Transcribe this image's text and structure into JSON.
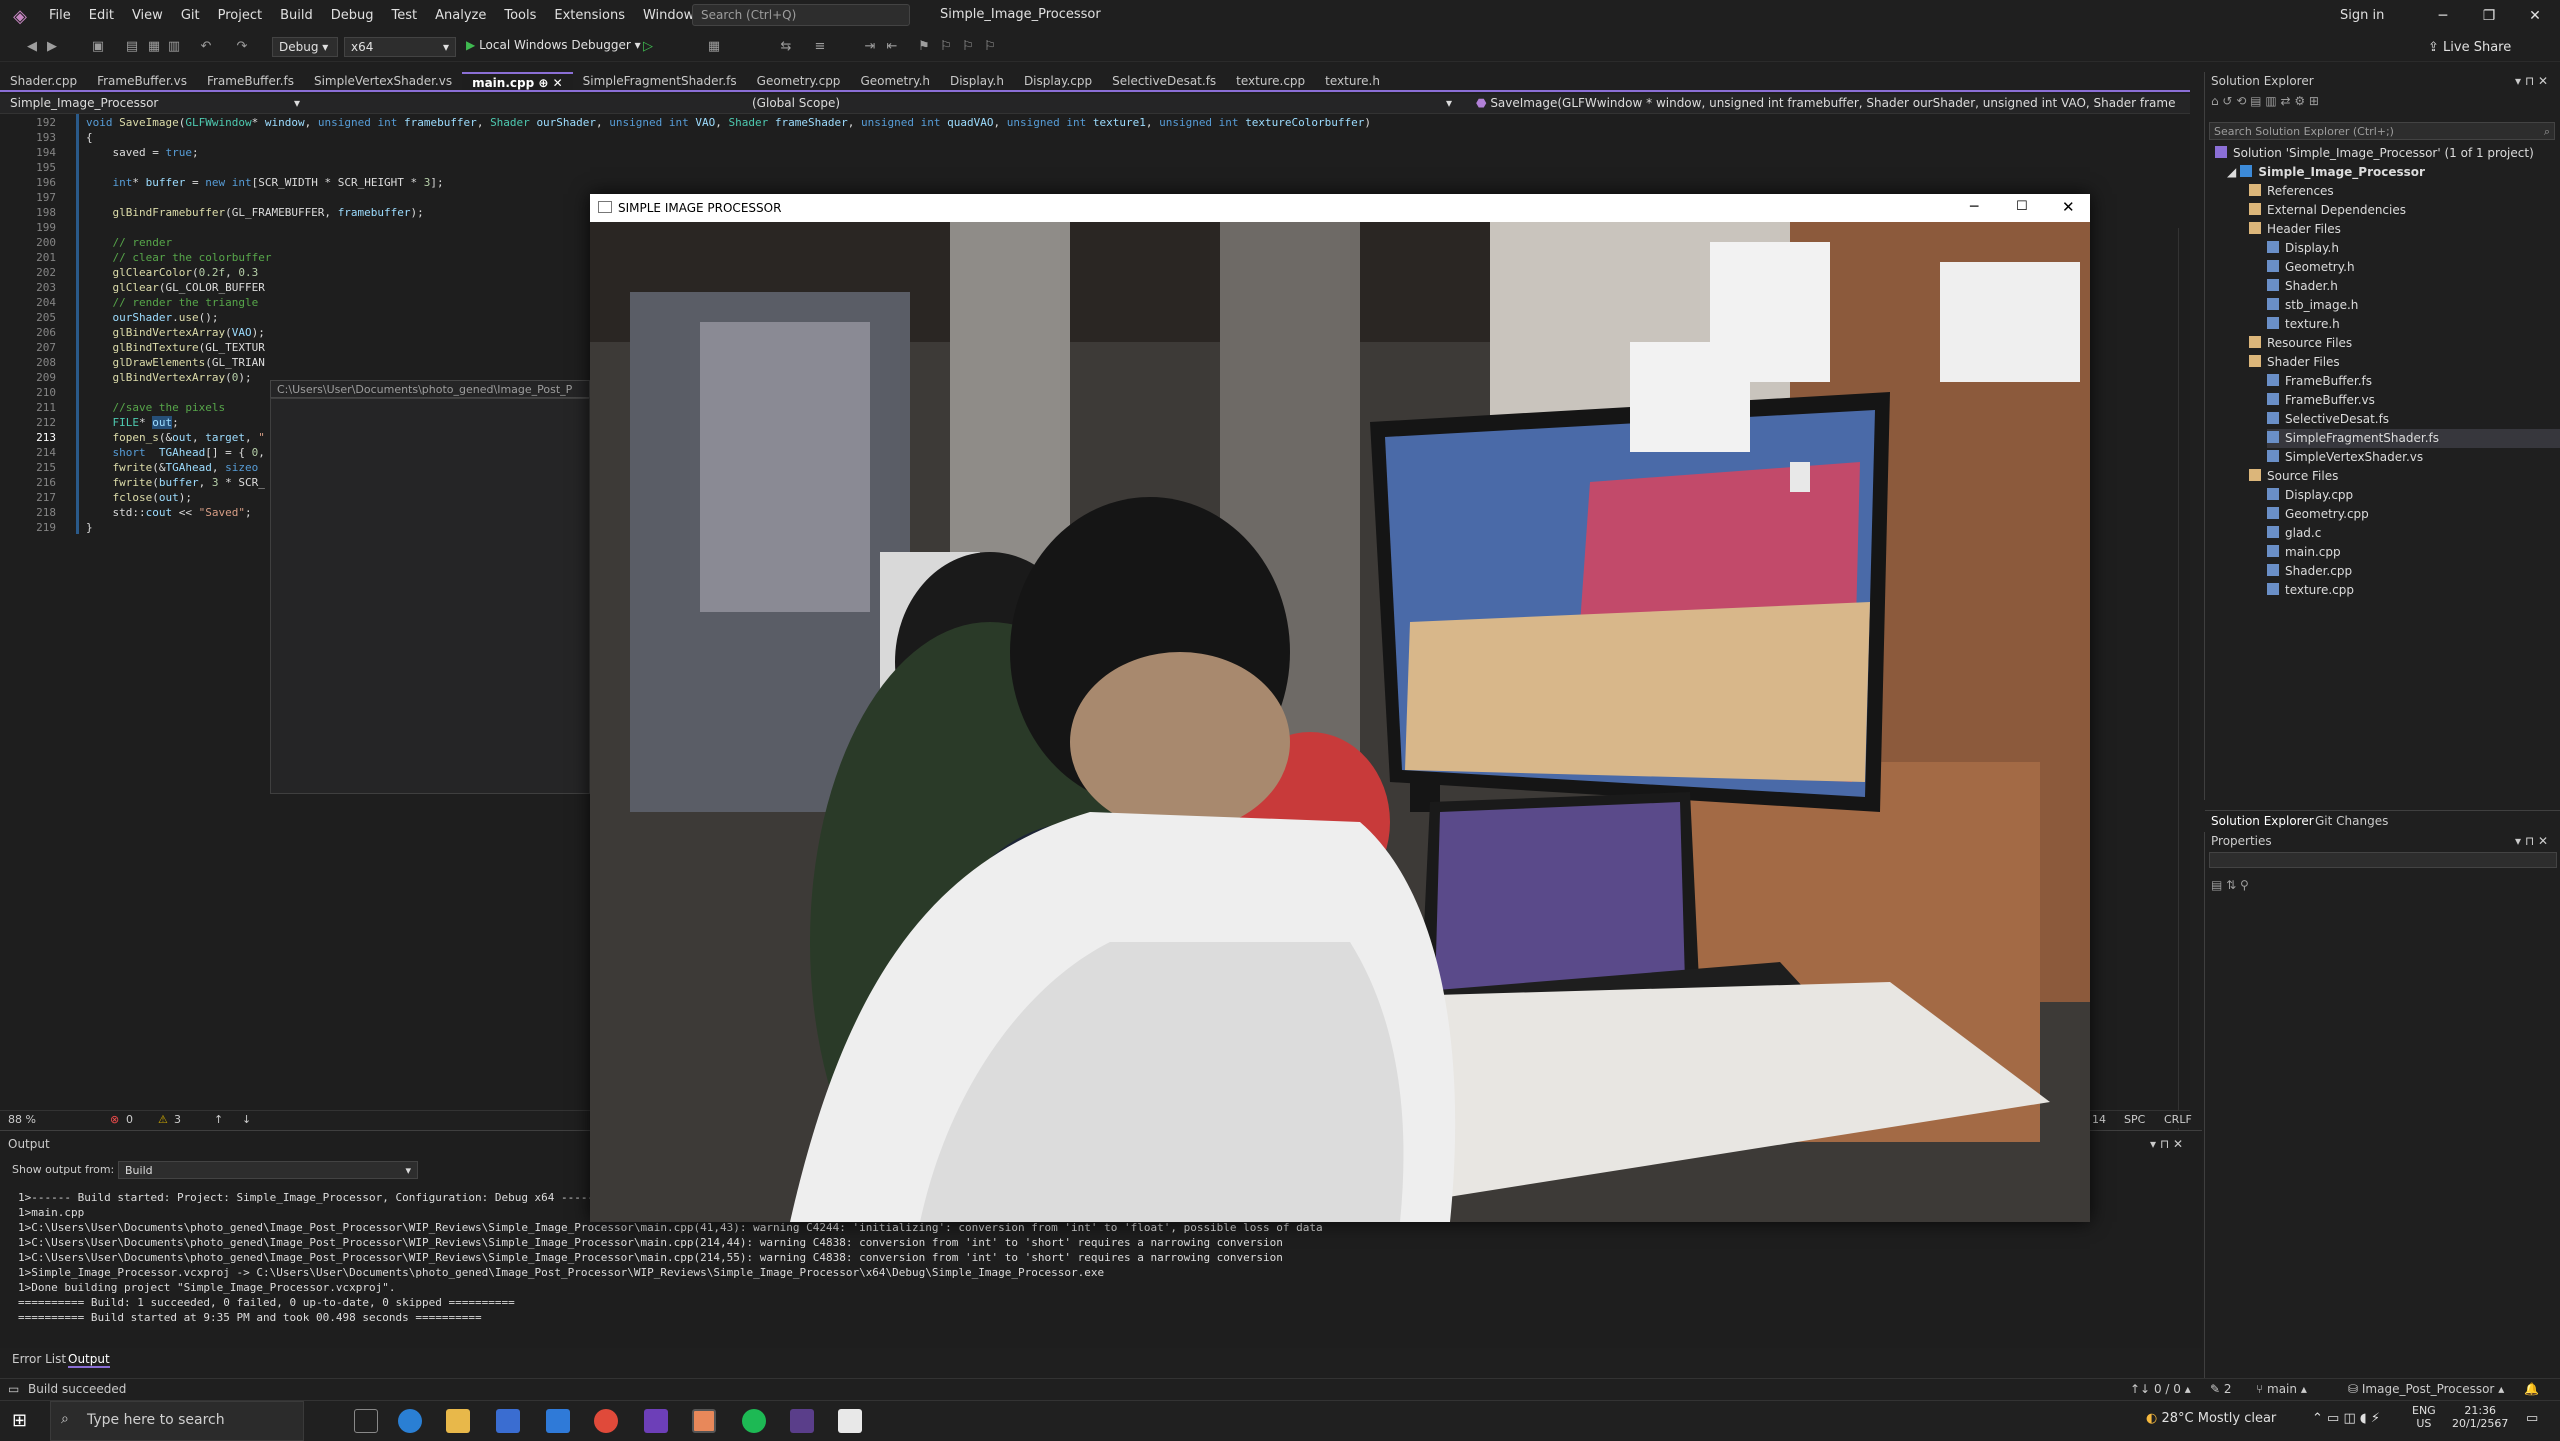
{
  "menu": [
    "File",
    "Edit",
    "View",
    "Git",
    "Project",
    "Build",
    "Debug",
    "Test",
    "Analyze",
    "Tools",
    "Extensions",
    "Window",
    "Help"
  ],
  "search_placeholder": "Search (Ctrl+Q)",
  "window_title": "Simple_Image_Processor",
  "sign_in": "Sign in",
  "live_share": "Live Share",
  "toolbar": {
    "config": "Debug",
    "platform": "x64",
    "run_label": "Local Windows Debugger"
  },
  "tabs": [
    "Shader.cpp",
    "FrameBuffer.vs",
    "FrameBuffer.fs",
    "SimpleVertexShader.vs",
    "main.cpp",
    "SimpleFragmentShader.fs",
    "Geometry.cpp",
    "Geometry.h",
    "Display.h",
    "Display.cpp",
    "SelectiveDesat.fs",
    "texture.cpp",
    "texture.h"
  ],
  "active_tab": "main.cpp",
  "nav": {
    "project": "Simple_Image_Processor",
    "scope": "(Global Scope)",
    "member": "SaveImage(GLFWwindow * window, unsigned int framebuffer, Shader ourShader, unsigned int VAO, Shader frameShader, unsigned"
  },
  "editor": {
    "lines": [
      192,
      193,
      194,
      195,
      196,
      197,
      198,
      199,
      200,
      201,
      202,
      203,
      204,
      205,
      206,
      207,
      208,
      209,
      210,
      211,
      212,
      213,
      214,
      215,
      216,
      217,
      218,
      219
    ],
    "tooltip": "C:\\Users\\User\\Documents\\photo_gened\\Image_Post_P"
  },
  "status_row": {
    "zoom": "88 %",
    "errors": "0",
    "warnings": "3",
    "col": "14",
    "spc": "SPC",
    "crlf": "CRLF"
  },
  "output": {
    "title": "Output",
    "show_from_label": "Show output from:",
    "source": "Build",
    "lines": [
      "1>------ Build started: Project: Simple_Image_Processor, Configuration: Debug x64 ------",
      "1>main.cpp",
      "1>C:\\Users\\User\\Documents\\photo_gened\\Image_Post_Processor\\WIP_Reviews\\Simple_Image_Processor\\main.cpp(41,43): warning C4244: 'initializing': conversion from 'int' to 'float', possible loss of data",
      "1>C:\\Users\\User\\Documents\\photo_gened\\Image_Post_Processor\\WIP_Reviews\\Simple_Image_Processor\\main.cpp(214,44): warning C4838: conversion from 'int' to 'short' requires a narrowing conversion",
      "1>C:\\Users\\User\\Documents\\photo_gened\\Image_Post_Processor\\WIP_Reviews\\Simple_Image_Processor\\main.cpp(214,55): warning C4838: conversion from 'int' to 'short' requires a narrowing conversion",
      "1>Simple_Image_Processor.vcxproj -> C:\\Users\\User\\Documents\\photo_gened\\Image_Post_Processor\\WIP_Reviews\\Simple_Image_Processor\\x64\\Debug\\Simple_Image_Processor.exe",
      "1>Done building project \"Simple_Image_Processor.vcxproj\".",
      "========== Build: 1 succeeded, 0 failed, 0 up-to-date, 0 skipped ==========",
      "========== Build started at 9:35 PM and took 00.498 seconds =========="
    ]
  },
  "bottom_tabs": [
    "Error List",
    "Output"
  ],
  "solution": {
    "title": "Solution Explorer",
    "search": "Search Solution Explorer (Ctrl+;)",
    "root": "Solution 'Simple_Image_Processor' (1 of 1 project)",
    "project": "Simple_Image_Processor",
    "items": [
      {
        "label": "References",
        "depth": 1
      },
      {
        "label": "External Dependencies",
        "depth": 1
      },
      {
        "label": "Header Files",
        "depth": 1
      },
      {
        "label": "Display.h",
        "depth": 2
      },
      {
        "label": "Geometry.h",
        "depth": 2
      },
      {
        "label": "Shader.h",
        "depth": 2
      },
      {
        "label": "stb_image.h",
        "depth": 2
      },
      {
        "label": "texture.h",
        "depth": 2
      },
      {
        "label": "Resource Files",
        "depth": 1
      },
      {
        "label": "Shader Files",
        "depth": 1
      },
      {
        "label": "FrameBuffer.fs",
        "depth": 2
      },
      {
        "label": "FrameBuffer.vs",
        "depth": 2
      },
      {
        "label": "SelectiveDesat.fs",
        "depth": 2
      },
      {
        "label": "SimpleFragmentShader.fs",
        "depth": 2
      },
      {
        "label": "SimpleVertexShader.vs",
        "depth": 2
      },
      {
        "label": "Source Files",
        "depth": 1
      },
      {
        "label": "Display.cpp",
        "depth": 2
      },
      {
        "label": "Geometry.cpp",
        "depth": 2
      },
      {
        "label": "glad.c",
        "depth": 2
      },
      {
        "label": "main.cpp",
        "depth": 2
      },
      {
        "label": "Shader.cpp",
        "depth": 2
      },
      {
        "label": "texture.cpp",
        "depth": 2
      }
    ],
    "tabs": [
      "Solution Explorer",
      "Git Changes"
    ]
  },
  "properties_title": "Properties",
  "vs_status": {
    "build": "Build succeeded",
    "sync": "0 / 0",
    "edits": "2",
    "branch": "main",
    "repo": "Image_Post_Processor"
  },
  "image_window": {
    "title": "SIMPLE IMAGE PROCESSOR"
  },
  "taskbar": {
    "search": "Type here to search",
    "weather": "28°C  Mostly clear",
    "lang1": "ENG",
    "lang2": "US",
    "time": "21:36",
    "date": "20/1/2567"
  }
}
